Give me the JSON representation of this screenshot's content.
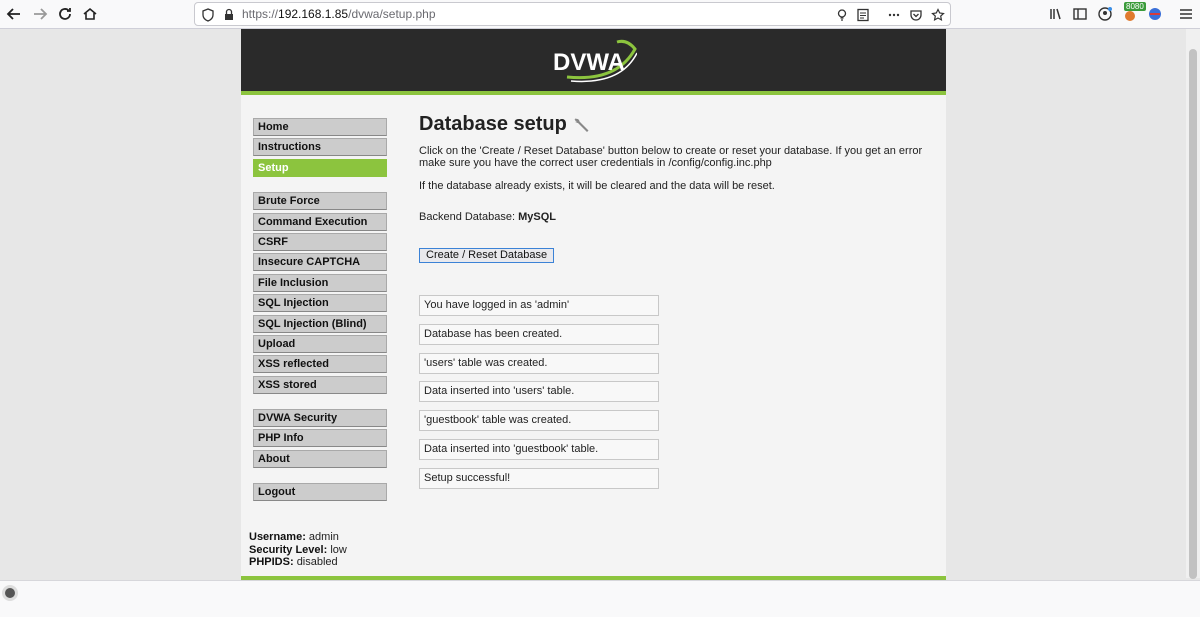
{
  "browser": {
    "url_prefix": "https://",
    "url_host": "192.168.1.85",
    "url_path": "/dvwa/setup.php",
    "badge": "8080"
  },
  "logo": {
    "text": "DVWA"
  },
  "menu": {
    "group1": [
      "Home",
      "Instructions",
      "Setup"
    ],
    "active": "Setup",
    "group2": [
      "Brute Force",
      "Command Execution",
      "CSRF",
      "Insecure CAPTCHA",
      "File Inclusion",
      "SQL Injection",
      "SQL Injection (Blind)",
      "Upload",
      "XSS reflected",
      "XSS stored"
    ],
    "group3": [
      "DVWA Security",
      "PHP Info",
      "About"
    ],
    "group4": [
      "Logout"
    ]
  },
  "content": {
    "title": "Database setup",
    "para1": "Click on the 'Create / Reset Database' button below to create or reset your database. If you get an error make sure you have the correct user credentials in /config/config.inc.php",
    "para2": "If the database already exists, it will be cleared and the data will be reset.",
    "backend_label": "Backend Database: ",
    "backend_value": "MySQL",
    "button_label": "Create / Reset Database",
    "messages": [
      "You have logged in as 'admin'",
      "Database has been created.",
      "'users' table was created.",
      "Data inserted into 'users' table.",
      "'guestbook' table was created.",
      "Data inserted into 'guestbook' table.",
      "Setup successful!"
    ]
  },
  "userinfo": {
    "username_label": "Username:",
    "username": "admin",
    "security_label": "Security Level:",
    "security": "low",
    "phpids_label": "PHPIDS:",
    "phpids": "disabled"
  },
  "colors": {
    "accent": "#8cc43e",
    "header": "#2a2a2a"
  }
}
